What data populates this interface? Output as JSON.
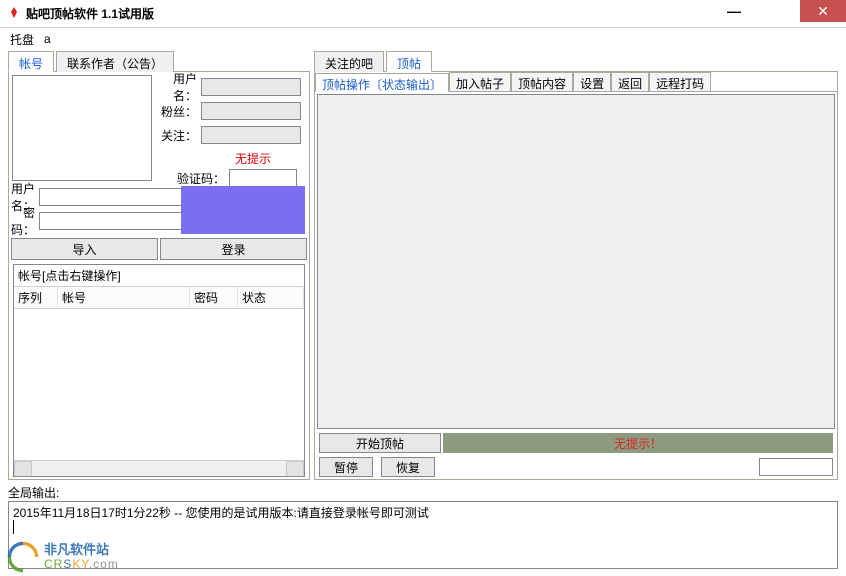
{
  "window": {
    "title": "贴吧顶帖软件  1.1试用版"
  },
  "toolbar": {
    "tray": "托盘",
    "avalue": "a"
  },
  "left": {
    "tabs": [
      "帐号",
      "联系作者（公告）"
    ],
    "form": {
      "user": "用户名：",
      "fans": "粉丝：",
      "follow": "关注：",
      "notip": "无提示",
      "captcha": "验证码："
    },
    "login": {
      "user": "用户名：",
      "pass": "密码：",
      "import": "导入",
      "login": "登录"
    },
    "list": {
      "header": "帐号[点击右键操作]",
      "cols": [
        "序列",
        "帐号",
        "密码",
        "状态"
      ]
    }
  },
  "right": {
    "tabs": [
      "关注的吧",
      "顶帖"
    ],
    "subtabs": {
      "main": "顶帖操作",
      "status": "〔状态输出〕",
      "items": [
        "加入帖子",
        "顶帖内容",
        "设置",
        "返回",
        "远程打码"
      ]
    },
    "actions": {
      "start": "开始顶帖",
      "status": "无提示！",
      "pause": "暂停",
      "resume": "恢复"
    }
  },
  "output": {
    "label": "全局输出:",
    "line": "2015年11月18日17时1分22秒 -- 您使用的是试用版本:请直接登录帐号即可测试"
  },
  "watermark": {
    "cn": "非凡软件站",
    "en": "CRSKY",
    "suffix": ".com"
  }
}
